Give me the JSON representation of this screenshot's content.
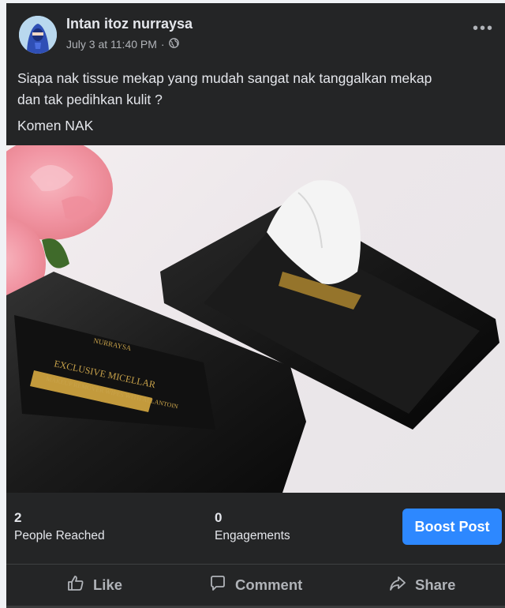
{
  "post": {
    "author": "Intan itoz nurraysa",
    "timestamp": "July 3 at 11:40 PM",
    "separator": "·",
    "audience_icon": "globe-icon",
    "more_icon": "more-options-icon",
    "text_line_1": "Siapa nak tissue mekap yang mudah sangat nak tanggalkan mekap",
    "text_line_2": "dan tak pedihkan kulit ?",
    "text_comment": "Komen NAK"
  },
  "product_image": {
    "brand_text": "NURRAYSA",
    "label_line_1": "EXCLUSIVE MICELLAR",
    "label_line_2": "MAKEUP REMOVER WIPES WITH ALLANTOIN"
  },
  "insights": {
    "reached_count": "2",
    "reached_label": "People Reached",
    "engagements_count": "0",
    "engagements_label": "Engagements",
    "boost_label": "Boost Post"
  },
  "actions": {
    "like": "Like",
    "comment": "Comment",
    "share": "Share"
  },
  "colors": {
    "card_bg": "#242526",
    "text_primary": "#e4e6eb",
    "text_secondary": "#b0b3b8",
    "accent": "#2d88ff"
  }
}
